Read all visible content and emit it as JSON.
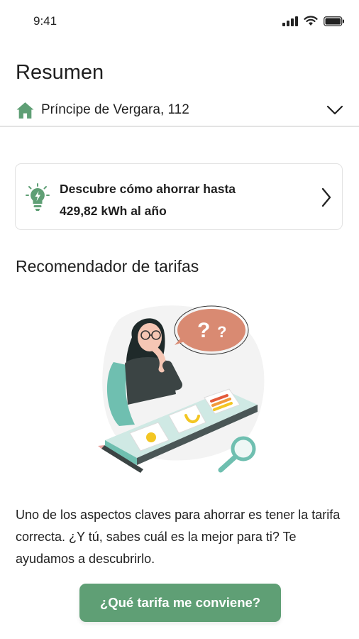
{
  "status_bar": {
    "time": "9:41",
    "icons": [
      "signal-icon",
      "wifi-icon",
      "battery-icon"
    ]
  },
  "header": {
    "title": "Resumen"
  },
  "address": {
    "text": "Príncipe de Vergara, 112",
    "icon": "house-icon",
    "dropdown_icon": "chevron-down-icon"
  },
  "savings_card": {
    "line1": "Descubre cómo ahorrar hasta",
    "line2": "429,82 kWh al año",
    "icon": "lightbulb-icon",
    "arrow_icon": "chevron-right-icon"
  },
  "recommender": {
    "title": "Recomendador de tarifas",
    "illustration": "woman-thinking-illustration",
    "description": "Uno de los aspectos claves para ahorrar es tener la tarifa correcta. ¿Y tú, sabes cuál es la mejor para ti? Te ayudamos a descubrirlo.",
    "button_label": "¿Qué tarifa me conviene?"
  },
  "colors": {
    "accent": "#5f9f75",
    "text": "#1f1f1f",
    "border": "#e2e2e2",
    "illustration_bubble": "#d98a72",
    "illustration_teal": "#6fbfb0"
  }
}
